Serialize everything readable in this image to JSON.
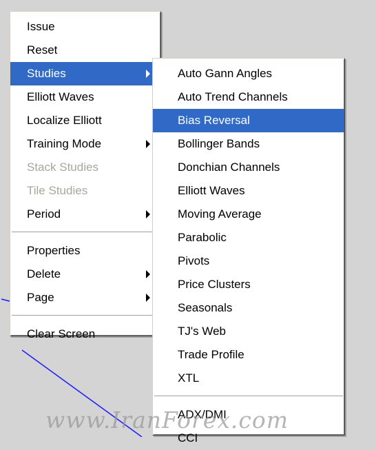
{
  "main_menu": {
    "items": [
      {
        "label": "Issue",
        "state": "normal"
      },
      {
        "label": "Reset",
        "state": "normal"
      },
      {
        "label": "Studies",
        "state": "highlighted",
        "submenu": true
      },
      {
        "label": "Elliott Waves",
        "state": "normal"
      },
      {
        "label": "Localize Elliott",
        "state": "normal"
      },
      {
        "label": "Training Mode",
        "state": "normal",
        "submenu": true
      },
      {
        "label": "Stack Studies",
        "state": "disabled"
      },
      {
        "label": "Tile Studies",
        "state": "disabled"
      },
      {
        "label": "Period",
        "state": "normal",
        "submenu": true
      },
      {
        "label": "Properties",
        "state": "normal"
      },
      {
        "label": "Delete",
        "state": "normal",
        "submenu": true
      },
      {
        "label": "Page",
        "state": "normal",
        "submenu": true
      },
      {
        "label": "Clear Screen",
        "state": "normal"
      }
    ]
  },
  "studies_submenu": {
    "items": [
      {
        "label": "Auto Gann Angles",
        "state": "normal"
      },
      {
        "label": "Auto Trend Channels",
        "state": "normal"
      },
      {
        "label": "Bias Reversal",
        "state": "highlighted"
      },
      {
        "label": "Bollinger Bands",
        "state": "normal"
      },
      {
        "label": "Donchian Channels",
        "state": "normal"
      },
      {
        "label": "Elliott Waves",
        "state": "normal"
      },
      {
        "label": "Moving Average",
        "state": "normal"
      },
      {
        "label": "Parabolic",
        "state": "normal"
      },
      {
        "label": "Pivots",
        "state": "normal"
      },
      {
        "label": "Price Clusters",
        "state": "normal"
      },
      {
        "label": "Seasonals",
        "state": "normal"
      },
      {
        "label": "TJ's Web",
        "state": "normal"
      },
      {
        "label": "Trade Profile",
        "state": "normal"
      },
      {
        "label": "XTL",
        "state": "normal"
      },
      {
        "label": "ADX/DMI",
        "state": "normal"
      },
      {
        "label": "CCI",
        "state": "normal"
      }
    ]
  },
  "watermark": {
    "text": "www.IranForex.com"
  },
  "colors": {
    "highlight": "#3169c6",
    "disabled_text": "#a8a69c",
    "chart_line": "#1a1aff",
    "background": "#d4d4d4"
  }
}
